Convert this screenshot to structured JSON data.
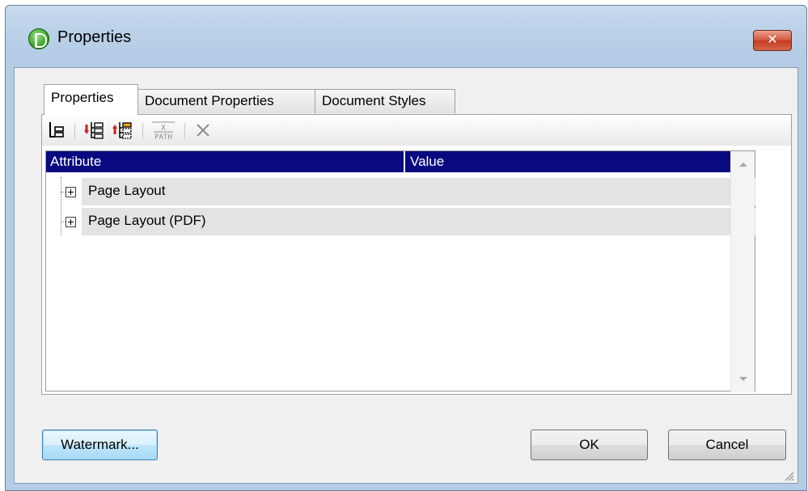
{
  "window": {
    "title": "Properties",
    "close_label": "✕"
  },
  "tabs": [
    {
      "label": "Properties",
      "active": true
    },
    {
      "label": "Document Properties",
      "active": false
    },
    {
      "label": "Document Styles",
      "active": false
    }
  ],
  "toolbar": {
    "items": [
      "tree-view-icon",
      "add-child-icon",
      "add-sibling-icon",
      "xpath-icon",
      "delete-icon"
    ],
    "xpath_label_top": "X",
    "xpath_label_bottom": "PATH"
  },
  "grid": {
    "columns": [
      "Attribute",
      "Value"
    ],
    "rows": [
      {
        "label": "Page Layout"
      },
      {
        "label": "Page Layout (PDF)"
      }
    ]
  },
  "buttons": {
    "watermark": "Watermark...",
    "ok": "OK",
    "cancel": "Cancel"
  },
  "colors": {
    "header_bg": "#0a0a80",
    "row_bg": "#e3e3e3",
    "close_button": "#c23a20"
  }
}
